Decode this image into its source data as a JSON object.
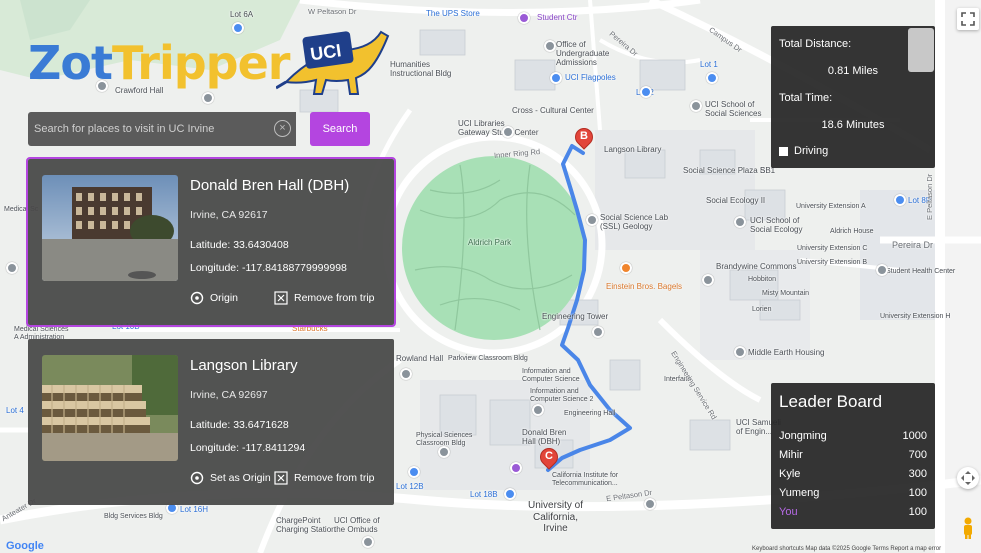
{
  "app": {
    "logo_word_1": "Zot",
    "logo_word_2": "Tripper",
    "logo_badge": "UCI"
  },
  "search": {
    "placeholder": "Search for places to visit in UC Irvine",
    "clear_icon": "close-circle-icon",
    "button_label": "Search"
  },
  "places": [
    {
      "name": "Donald Bren Hall (DBH)",
      "address": "Irvine, CA 92617",
      "latitude_label": "Latitude: 33.6430408",
      "longitude_label": "Longitude: -117.84188779999998",
      "primary_action": "Origin",
      "primary_icon": "target-icon",
      "remove_action": "Remove from trip",
      "remove_icon": "close-box-icon"
    },
    {
      "name": "Langson Library",
      "address": "Irvine, CA 92697",
      "latitude_label": "Latitude: 33.6471628",
      "longitude_label": "Longitude: -117.8411294",
      "primary_action": "Set as Origin",
      "primary_icon": "target-icon",
      "remove_action": "Remove from trip",
      "remove_icon": "close-box-icon"
    }
  ],
  "stats": {
    "distance_label": "Total Distance:",
    "distance_value": "0.81 Miles",
    "time_label": "Total Time:",
    "time_value": "18.6 Minutes",
    "mode_label": "Driving",
    "mode_checked": false
  },
  "leaderboard": {
    "title": "Leader Board",
    "rows": [
      {
        "name": "Jongming",
        "score": "1000"
      },
      {
        "name": "Mihir",
        "score": "700"
      },
      {
        "name": "Kyle",
        "score": "300"
      },
      {
        "name": "Yumeng",
        "score": "100"
      },
      {
        "name": "You",
        "score": "100"
      }
    ]
  },
  "map": {
    "markers": [
      "B",
      "C"
    ],
    "labels": {
      "lot6a": "Lot 6A",
      "w_peltason": "W Peltason Dr",
      "ups": "The UPS Store",
      "student_ctr": "Student Ctr",
      "humanities": "Humanities\nInstructional Bldg",
      "office_admissions": "Office of\nUndergraduate\nAdmissions",
      "pereira": "Pereira Dr",
      "campus_dr": "Campus Dr",
      "lot1": "Lot 1",
      "lot2": "Lot 2",
      "flagpoles": "UCI Flagpoles",
      "crawford": "Crawford Hall",
      "cross_cultural": "Cross - Cultural Center",
      "gateway": "UCI Libraries\nGateway Study Center",
      "social_sciences": "UCI School of\nSocial Sciences",
      "langson_map": "Langson Library",
      "inner_ring": "Inner Ring Rd",
      "aldrich": "Aldrich Park",
      "ss_plaza": "Social Science Plaza B",
      "sb1": "SB1",
      "ecology2": "Social Ecology II",
      "school_ecology": "UCI School of\nSocial Ecology",
      "ssl": "Social Science Lab\n(SSL) Geology",
      "ext2": "University Extension A",
      "aldrich_house": "Aldrich House",
      "ext_c": "University Extension C",
      "ext_b": "University Extension B",
      "lot8p": "Lot 8P",
      "pereira2": "Pereira Dr",
      "brandywine": "Brandywine Commons",
      "hobbiton": "Hobbiton",
      "einstein": "Einstein Bros. Bagels",
      "misty": "Misty Mountain",
      "lorien": "Lorien",
      "student_health": "Student Health Center",
      "ext_hall": "University Extension H",
      "eng_tower": "Engineering Tower",
      "middle_earth": "Middle Earth Housing",
      "starbucks": "Starbucks",
      "lot10b": "Lot 10B",
      "medical": "Medical Sciences\nA Administration",
      "rowland": "Rowland Hall",
      "parkview": "Parkview Classroom Bldg",
      "ics": "Information and\nComputer Science",
      "ics2": "Information and\nComputer Science 2",
      "eng_hall": "Engineering Hall",
      "interfaith": "Interfaith",
      "physical": "Physical Sciences\nClassroom Bldg",
      "dbh_map": "Donald Bren\nHall (DBH)",
      "calit2": "California Institute for\nTelecommunication...",
      "lot12b": "Lot 12B",
      "lot18b": "Lot 18B",
      "e_peltason": "E Peltason Dr",
      "uci": "University of\nCalifornia,\nIrvine",
      "chargepoint": "ChargePoint\nCharging Station",
      "ombuds": "UCI Office of\nthe Ombuds",
      "bldg_services": "Bldg Services Bldg",
      "lot16h": "Lot 16H",
      "lot4": "Lot 4",
      "anteater": "Anteater Dr",
      "uci_samueli": "UCI Samueli\nof Engin...",
      "e_peltason_v": "E Peltason Dr",
      "medical_left": "Medical Sc",
      "eng_svc": "Engineering Service Rd"
    }
  },
  "google_logo": "Google",
  "attribution": "Keyboard shortcuts   Map data ©2025 Google   Terms   Report a map error"
}
